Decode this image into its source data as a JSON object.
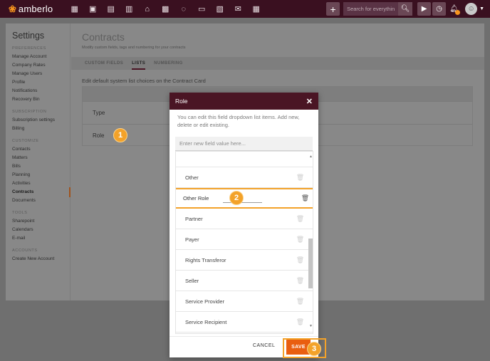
{
  "app": {
    "name": "amberlo",
    "logo_icon": "amberlo-logo-icon"
  },
  "topbar": {
    "nav_icons": [
      {
        "name": "dashboard-icon",
        "glyph": "▦"
      },
      {
        "name": "contacts-icon",
        "glyph": "▣"
      },
      {
        "name": "matters-icon",
        "glyph": "▤"
      },
      {
        "name": "documents-icon",
        "glyph": "▥"
      },
      {
        "name": "bank-icon",
        "glyph": "⌂"
      },
      {
        "name": "calendar-icon",
        "glyph": "▩"
      },
      {
        "name": "whatsapp-icon",
        "glyph": "◌"
      },
      {
        "name": "folder-icon",
        "glyph": "▭"
      },
      {
        "name": "files-icon",
        "glyph": "▧"
      },
      {
        "name": "mail-icon",
        "glyph": "✉"
      },
      {
        "name": "reports-icon",
        "glyph": "▦"
      }
    ],
    "add_label": "+",
    "search_placeholder": "Search for everything...",
    "search_icon": "search-icon",
    "play_icon": "play-icon",
    "timer_icon": "timer-icon",
    "bell_icon": "bell-icon",
    "avatar_icon": "avatar-icon"
  },
  "sidebar": {
    "title": "Settings",
    "sections": [
      {
        "label": "PREFERENCES",
        "items": [
          "Manage Account",
          "Company Rates",
          "Manage Users",
          "Profile",
          "Notifications",
          "Recovery Bin"
        ]
      },
      {
        "label": "SUBSCRIPTION",
        "items": [
          "Subscription settings",
          "Billing"
        ]
      },
      {
        "label": "CUSTOMIZE",
        "items": [
          "Contacts",
          "Matters",
          "Bills",
          "Planning",
          "Activities",
          "Contracts",
          "Documents"
        ]
      },
      {
        "label": "TOOLS",
        "items": [
          "Sharepoint",
          "Calendars",
          "E-mail"
        ]
      },
      {
        "label": "ACCOUNTS",
        "items": [
          "Create New Account"
        ]
      }
    ],
    "active_item": "Contracts"
  },
  "main": {
    "title": "Contracts",
    "subtitle": "Modify custom fields, tags and numbering for your contracts",
    "tabs": [
      {
        "label": "CUSTOM FIELDS",
        "active": false
      },
      {
        "label": "LISTS",
        "active": true
      },
      {
        "label": "NUMBERING",
        "active": false
      }
    ],
    "lists_heading": "Edit default system list choices on the Contract Card",
    "rows": [
      "Type",
      "Role"
    ]
  },
  "callouts": [
    "1",
    "2",
    "3"
  ],
  "modal": {
    "title": "Role",
    "close_label": "✕",
    "description": "You can edit this field dropdown list items. Add new, delete or edit existing.",
    "new_value_placeholder": "Enter new field value here...",
    "items": [
      "Other",
      "Other Role",
      "Partner",
      "Payer",
      "Rights Transferor",
      "Seller",
      "Service Provider",
      "Service Recipient"
    ],
    "editing_index": 1,
    "editing_value": "Other Role",
    "cancel_label": "CANCEL",
    "save_label": "SAVE"
  },
  "colors": {
    "brand": "#4a1524",
    "accent": "#f3a229",
    "save": "#e95e10",
    "logo": "#f7941d"
  }
}
